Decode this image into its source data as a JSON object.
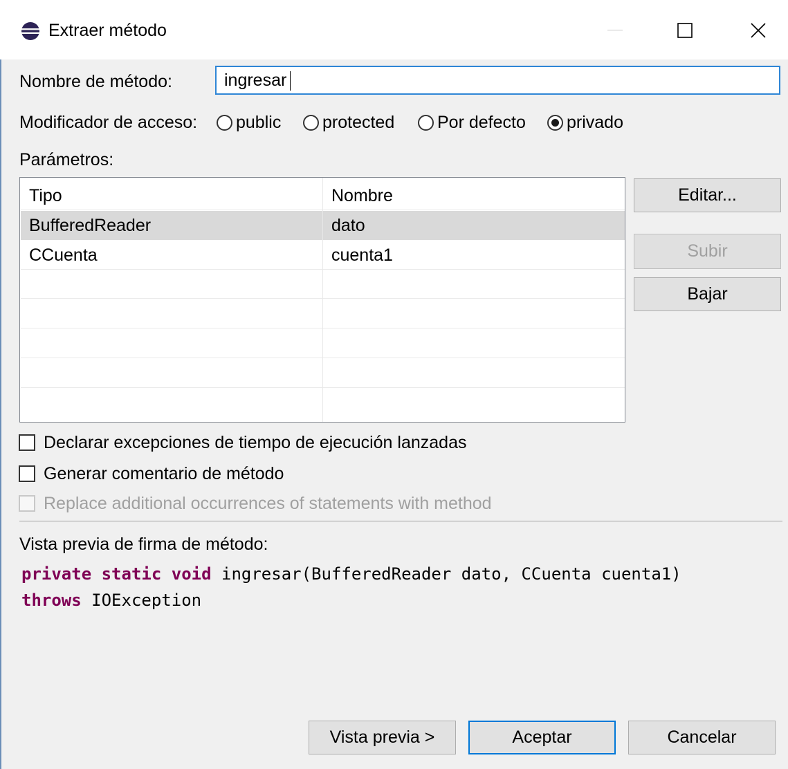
{
  "window": {
    "title": "Extraer método",
    "icon": "eclipse-icon",
    "minimize_icon": "minimize-icon",
    "maximize_icon": "maximize-icon",
    "close_icon": "close-icon"
  },
  "method_name": {
    "label": "Nombre de método:",
    "value": "ingresar"
  },
  "access_modifier": {
    "label": "Modificador de acceso:",
    "options": [
      "public",
      "protected",
      "Por defecto",
      "privado"
    ],
    "selected": "privado"
  },
  "parameters": {
    "label": "Parámetros:",
    "columns": [
      "Tipo",
      "Nombre"
    ],
    "rows": [
      {
        "type": "BufferedReader",
        "name": "dato"
      },
      {
        "type": "CCuenta",
        "name": "cuenta1"
      }
    ],
    "buttons": {
      "edit": "Editar...",
      "up": "Subir",
      "down": "Bajar"
    }
  },
  "options": {
    "declare_exceptions": "Declarar excepciones de tiempo de ejecución lanzadas",
    "generate_comment": "Generar comentario de método",
    "replace_occurrences": "Replace additional occurrences of statements with method"
  },
  "preview": {
    "label": "Vista previa de firma de método:",
    "line1_keywords": "private static void",
    "line1_rest": " ingresar(BufferedReader dato, CCuenta cuenta1)",
    "line2_keyword": "throws",
    "line2_rest": " IOException"
  },
  "footer": {
    "preview": "Vista previa >",
    "accept": "Aceptar",
    "cancel": "Cancelar"
  },
  "colors": {
    "keyword": "#7f0055",
    "focus_border": "#0078d7",
    "selected_row": "#d9d9d9"
  }
}
